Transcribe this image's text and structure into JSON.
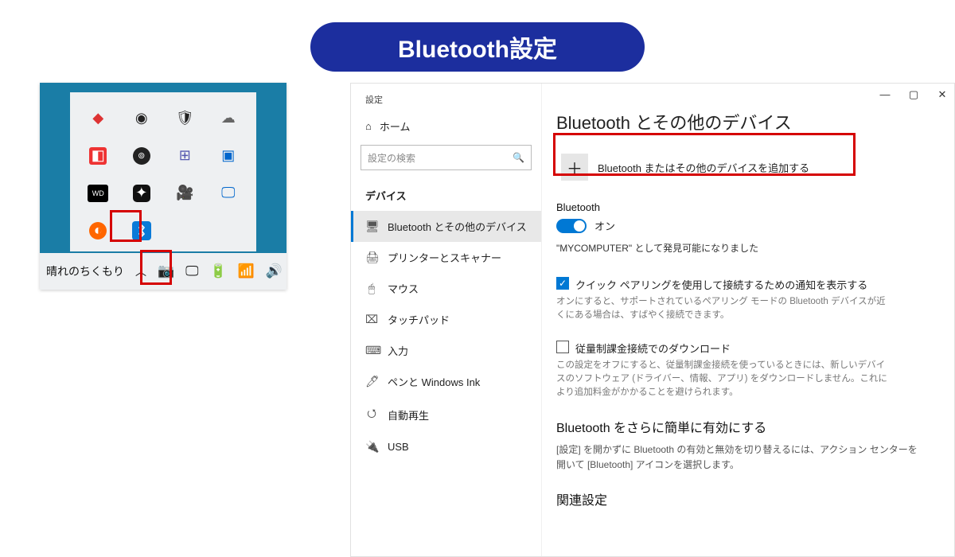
{
  "banner": {
    "title": "Bluetooth設定"
  },
  "tray": {
    "weather": "晴れのちくもり",
    "chevron": "︿",
    "icons": [
      "camera",
      "record",
      "battery",
      "wifi",
      "volume"
    ],
    "popup_icons": [
      "app-red",
      "circle-dot",
      "shield-check",
      "cloud-off",
      "diamond-red",
      "cc-circle",
      "teams",
      "screen-blue",
      "wd-black",
      "app-dark",
      "webcam",
      "screen-c",
      "orange-app",
      "bluetooth",
      "",
      ""
    ]
  },
  "settings": {
    "app_title": "設定",
    "home": "ホーム",
    "search_placeholder": "設定の検索",
    "section": "デバイス",
    "nav": [
      {
        "icon": "🖥",
        "label": "Bluetooth とその他のデバイス",
        "active": true
      },
      {
        "icon": "🖨",
        "label": "プリンターとスキャナー",
        "active": false
      },
      {
        "icon": "🖱",
        "label": "マウス",
        "active": false
      },
      {
        "icon": "⌧",
        "label": "タッチパッド",
        "active": false
      },
      {
        "icon": "⌨",
        "label": "入力",
        "active": false
      },
      {
        "icon": "🖊",
        "label": "ペンと Windows Ink",
        "active": false
      },
      {
        "icon": "⭯",
        "label": "自動再生",
        "active": false
      },
      {
        "icon": "🔌",
        "label": "USB",
        "active": false
      }
    ],
    "page": {
      "heading": "Bluetooth とその他のデバイス",
      "add_device": "Bluetooth またはその他のデバイスを追加する",
      "bt_label": "Bluetooth",
      "bt_state": "オン",
      "discoverable": "\"MYCOMPUTER\" として発見可能になりました",
      "quick_pair_label": "クイック ペアリングを使用して接続するための通知を表示する",
      "quick_pair_help": "オンにすると、サポートされているペアリング モードの Bluetooth デバイスが近くにある場合は、すばやく接続できます。",
      "metered_label": "従量制課金接続でのダウンロード",
      "metered_help": "この設定をオフにすると、従量制課金接続を使っているときには、新しいデバイスのソフトウェア (ドライバー、情報、アプリ) をダウンロードしません。これにより追加料金がかかることを避けられます。",
      "more_title": "Bluetooth をさらに簡単に有効にする",
      "more_body": "[設定] を開かずに Bluetooth の有効と無効を切り替えるには、アクション センターを開いて [Bluetooth] アイコンを選択します。",
      "related_title": "関連設定"
    }
  }
}
